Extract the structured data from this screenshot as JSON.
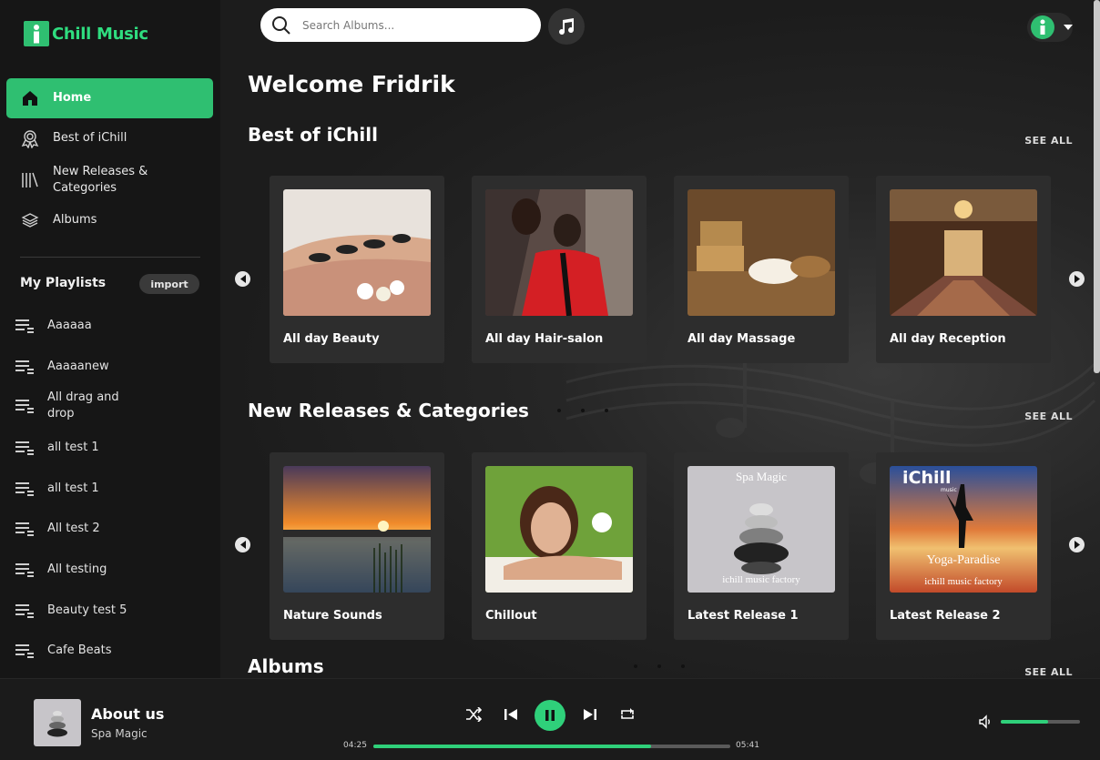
{
  "brand": {
    "name": "Chill Music",
    "logo_letter": "i",
    "accent": "#2fbf71"
  },
  "nav": [
    {
      "label": "Home",
      "icon": "home-icon",
      "active": true
    },
    {
      "label": "Best of iChill",
      "icon": "award-icon",
      "active": false
    },
    {
      "label": "New Releases & Categories",
      "icon": "library-icon",
      "active": false
    },
    {
      "label": "Albums",
      "icon": "layers-icon",
      "active": false
    }
  ],
  "playlists": {
    "title": "My Playlists",
    "import_label": "import",
    "items": [
      "Aaaaaa",
      "Aaaaanew",
      "All drag and drop",
      "all test 1",
      "all test 1",
      "All test 2",
      "All testing",
      "Beauty test 5",
      "Cafe Beats"
    ]
  },
  "header": {
    "search_placeholder": "Search Albums..."
  },
  "main": {
    "welcome": "Welcome Fridrik",
    "see_all": "SEE ALL",
    "sections": [
      {
        "title": "Best of iChill",
        "cards": [
          "All day Beauty",
          "All day Hair-salon",
          "All day Massage",
          "All day Reception"
        ]
      },
      {
        "title": "New Releases & Categories",
        "cards": [
          "Nature Sounds",
          "Chillout",
          "Latest Release 1",
          "Latest Release 2"
        ]
      },
      {
        "title": "Albums",
        "cards": []
      }
    ],
    "cover_text": {
      "spa_magic": "Spa Magic",
      "factory": "ichill music factory",
      "ichill": "iChill",
      "music": "music",
      "yoga": "Yoga-Paradise"
    }
  },
  "player": {
    "title": "About us",
    "artist": "Spa Magic",
    "elapsed": "04:25",
    "duration": "05:41",
    "progress": 0.777,
    "volume": 0.6
  }
}
